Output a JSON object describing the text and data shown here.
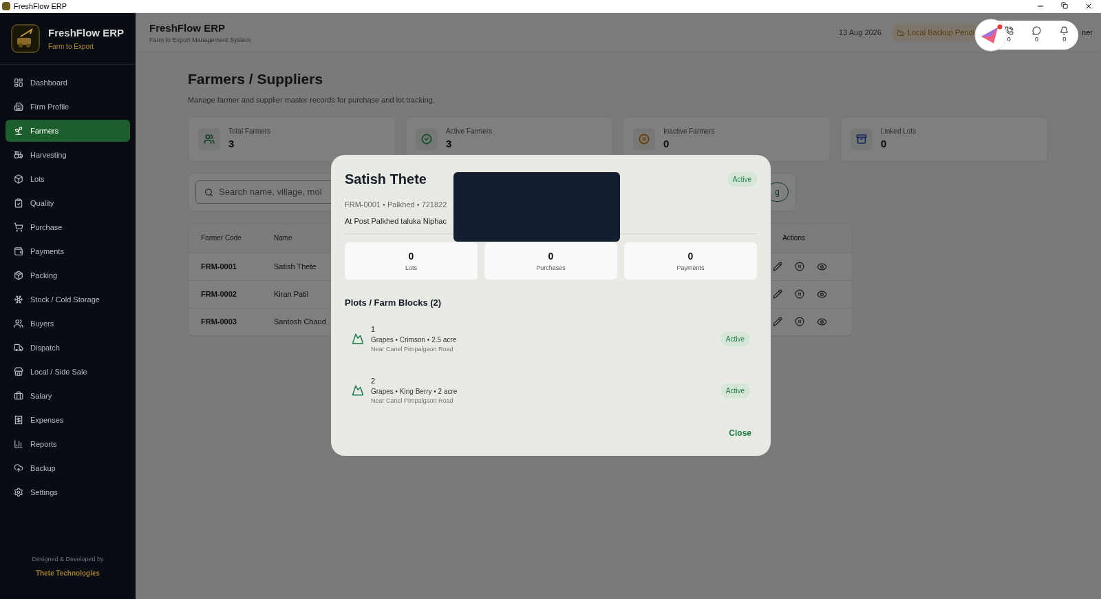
{
  "window": {
    "title": "FreshFlow ERP"
  },
  "sidebar": {
    "brand": "FreshFlow ERP",
    "tagline": "Farm to Export",
    "items": [
      {
        "label": "Dashboard",
        "selected": false
      },
      {
        "label": "Firm Profile",
        "selected": false
      },
      {
        "label": "Farmers",
        "selected": true
      },
      {
        "label": "Harvesting",
        "selected": false
      },
      {
        "label": "Lots",
        "selected": false
      },
      {
        "label": "Quality",
        "selected": false
      },
      {
        "label": "Purchase",
        "selected": false
      },
      {
        "label": "Payments",
        "selected": false
      },
      {
        "label": "Packing",
        "selected": false
      },
      {
        "label": "Stock / Cold Storage",
        "selected": false
      },
      {
        "label": "Buyers",
        "selected": false
      },
      {
        "label": "Dispatch",
        "selected": false
      },
      {
        "label": "Local / Side Sale",
        "selected": false
      },
      {
        "label": "Salary",
        "selected": false
      },
      {
        "label": "Expenses",
        "selected": false
      },
      {
        "label": "Reports",
        "selected": false
      },
      {
        "label": "Backup",
        "selected": false
      },
      {
        "label": "Settings",
        "selected": false
      }
    ],
    "credit": "Designed & Developed by",
    "company": "Thete Technologies"
  },
  "header": {
    "title": "FreshFlow ERP",
    "subtitle": "Farm to Export Management System",
    "date": "13 Aug 2026",
    "backup": "Local Backup Pendi",
    "user": "ner"
  },
  "widget": {
    "counts": [
      "0",
      "0",
      "0"
    ]
  },
  "page": {
    "title": "Farmers / Suppliers",
    "description": "Manage farmer and supplier master records for purchase and lot tracking."
  },
  "stats": [
    {
      "label": "Total Farmers",
      "value": "3",
      "color": "#0f3e23"
    },
    {
      "label": "Active Farmers",
      "value": "3",
      "color": "#115026"
    },
    {
      "label": "Inactive Farmers",
      "value": "0",
      "color": "#6d3c03"
    },
    {
      "label": "Linked Lots",
      "value": "0",
      "color": "#17285c"
    }
  ],
  "search": {
    "placeholder": "Search name, village, mol",
    "button": "g"
  },
  "table": {
    "columns": [
      "Farmer Code",
      "Name",
      "Actions"
    ],
    "rows": [
      {
        "code": "FRM-0001",
        "name": "Satish Thete"
      },
      {
        "code": "FRM-0002",
        "name": "Kiran Patil"
      },
      {
        "code": "FRM-0003",
        "name": "Santosh Chaud"
      }
    ]
  },
  "modal": {
    "name": "Satish Thete",
    "status": "Active",
    "meta": "FRM-0001 • Palkhed • 721822",
    "address": "At Post Palkhed taluka Niphac",
    "counts": [
      {
        "value": "0",
        "label": "Lots"
      },
      {
        "value": "0",
        "label": "Purchases"
      },
      {
        "value": "0",
        "label": "Payments"
      }
    ],
    "plots_title": "Plots / Farm Blocks (2)",
    "plots": [
      {
        "name": "1",
        "detail": "Grapes • Crimson • 2.5 acre",
        "location": "Near Canel Pimpalgaon Road",
        "status": "Active"
      },
      {
        "name": "2",
        "detail": "Grapes • King Berry • 2 acre",
        "location": "Near Canel Pimpalgaon Road",
        "status": "Active"
      }
    ],
    "close": "Close"
  }
}
